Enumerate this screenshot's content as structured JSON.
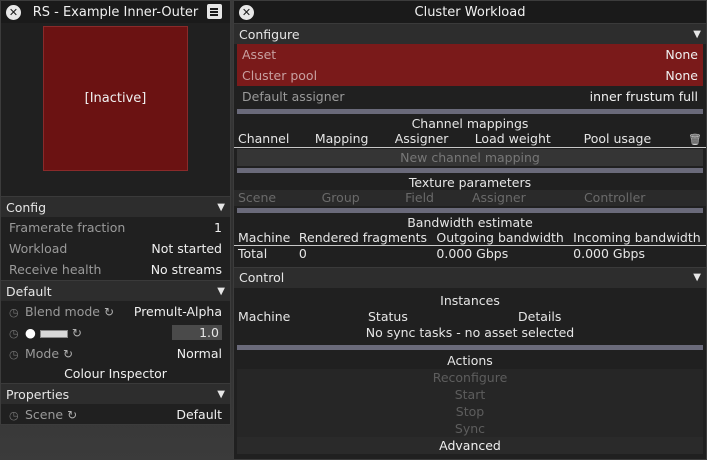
{
  "left_panel": {
    "title": "RS - Example Inner-Outer",
    "preview_label": "[Inactive]",
    "config": {
      "header": "Config",
      "rows": [
        {
          "label": "Framerate fraction",
          "value": "1"
        },
        {
          "label": "Workload",
          "value": "Not started"
        },
        {
          "label": "Receive health",
          "value": "No streams"
        }
      ]
    },
    "default": {
      "header": "Default",
      "blend_mode_label": "Blend mode",
      "blend_mode_value": "Premult-Alpha",
      "brightness_value": "1.0",
      "mode_label": "Mode",
      "mode_value": "Normal",
      "colour_inspector": "Colour Inspector"
    },
    "properties": {
      "header": "Properties",
      "scene_label": "Scene",
      "scene_value": "Default"
    }
  },
  "right_panel": {
    "title": "Cluster Workload",
    "configure": {
      "header": "Configure",
      "asset_label": "Asset",
      "asset_value": "None",
      "cluster_pool_label": "Cluster pool",
      "cluster_pool_value": "None",
      "default_assigner_label": "Default assigner",
      "default_assigner_value": "inner frustum full"
    },
    "channel_mappings": {
      "title": "Channel mappings",
      "columns": [
        "Channel",
        "Mapping",
        "Assigner",
        "Load weight",
        "Pool usage"
      ],
      "new_button": "New channel mapping"
    },
    "texture_parameters": {
      "title": "Texture parameters",
      "columns": [
        "Scene",
        "Group",
        "Field",
        "Assigner",
        "Controller"
      ]
    },
    "bandwidth": {
      "title": "Bandwidth estimate",
      "columns": [
        "Machine",
        "Rendered fragments",
        "Outgoing bandwidth",
        "Incoming bandwidth"
      ],
      "total_row": [
        "Total",
        "0",
        "0.000 Gbps",
        "0.000 Gbps"
      ]
    },
    "control": {
      "header": "Control",
      "instances_title": "Instances",
      "columns": [
        "Machine",
        "Status",
        "Details"
      ],
      "empty_message": "No sync tasks - no asset selected",
      "actions_title": "Actions",
      "actions": [
        "Reconfigure",
        "Start",
        "Stop",
        "Sync",
        "Advanced"
      ]
    }
  },
  "colors": {
    "error_red": "#7a1a1a",
    "preview_red": "#6b1212",
    "panel_bg": "#202020"
  }
}
